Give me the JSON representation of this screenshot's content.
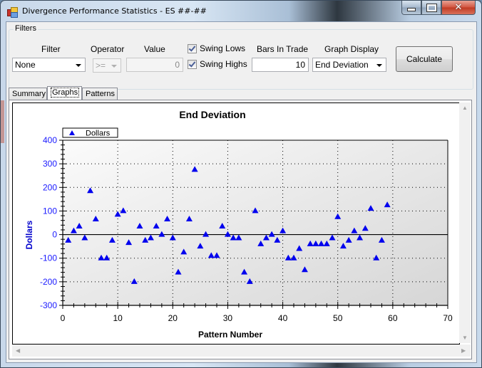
{
  "window": {
    "title": "Divergence Performance Statistics - ES ##-##",
    "controls": [
      "minimize",
      "maximize",
      "close"
    ]
  },
  "filters": {
    "group_label": "Filters",
    "filter_label": "Filter",
    "filter_value": "None",
    "operator_label": "Operator",
    "operator_value": ">=",
    "value_label": "Value",
    "value_value": "0",
    "swing_lows_label": "Swing Lows",
    "swing_lows_checked": true,
    "swing_highs_label": "Swing Highs",
    "swing_highs_checked": true,
    "bars_in_trade_label": "Bars In Trade",
    "bars_in_trade_value": "10",
    "graph_display_label": "Graph Display",
    "graph_display_value": "End Deviation",
    "calculate_label": "Calculate"
  },
  "tabs": [
    {
      "label": "Summary",
      "active": false
    },
    {
      "label": "Graphs",
      "active": true
    },
    {
      "label": "Patterns",
      "active": false
    }
  ],
  "chart_data": {
    "type": "scatter",
    "title": "End Deviation",
    "xlabel": "Pattern Number",
    "ylabel": "Dollars",
    "xlim": [
      0,
      70
    ],
    "ylim": [
      -300,
      400
    ],
    "xticks": [
      0,
      10,
      20,
      30,
      40,
      50,
      60,
      70
    ],
    "yticks": [
      -300,
      -200,
      -100,
      0,
      100,
      200,
      300,
      400
    ],
    "grid": true,
    "legend": "top-left",
    "marker": "triangle",
    "color": "#0000ee",
    "series": [
      {
        "name": "Dollars",
        "x": [
          1,
          2,
          3,
          4,
          5,
          6,
          7,
          8,
          9,
          10,
          11,
          12,
          13,
          14,
          15,
          16,
          17,
          18,
          19,
          20,
          21,
          22,
          23,
          24,
          25,
          26,
          27,
          28,
          29,
          30,
          31,
          32,
          33,
          34,
          35,
          36,
          37,
          38,
          39,
          40,
          41,
          42,
          43,
          44,
          45,
          46,
          47,
          48,
          49,
          50,
          51,
          52,
          53,
          54,
          55,
          56,
          57,
          58,
          59
        ],
        "y": [
          -25,
          15,
          35,
          -15,
          185,
          65,
          -100,
          -100,
          -25,
          85,
          100,
          -35,
          -200,
          35,
          -25,
          -15,
          35,
          0,
          65,
          -15,
          -160,
          -75,
          65,
          275,
          -50,
          0,
          -90,
          -90,
          35,
          0,
          -15,
          -15,
          -160,
          -200,
          100,
          -40,
          -15,
          0,
          -25,
          15,
          -100,
          -100,
          -60,
          -150,
          -40,
          -40,
          -40,
          -40,
          -15,
          75,
          -50,
          -25,
          15,
          -15,
          25,
          110,
          -100,
          -25,
          125
        ]
      }
    ]
  }
}
